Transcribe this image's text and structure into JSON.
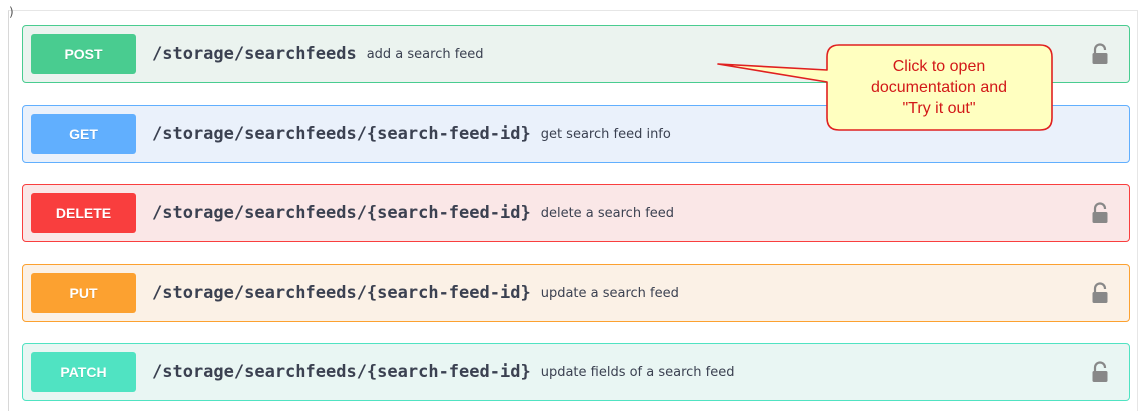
{
  "operations": [
    {
      "method": "POST",
      "path": "/storage/searchfeeds",
      "summary": "add a search feed",
      "locked": true
    },
    {
      "method": "GET",
      "path": "/storage/searchfeeds/{search-feed-id}",
      "summary": "get search feed info",
      "locked": false
    },
    {
      "method": "DELETE",
      "path": "/storage/searchfeeds/{search-feed-id}",
      "summary": "delete a search feed",
      "locked": true
    },
    {
      "method": "PUT",
      "path": "/storage/searchfeeds/{search-feed-id}",
      "summary": "update a search feed",
      "locked": true
    },
    {
      "method": "PATCH",
      "path": "/storage/searchfeeds/{search-feed-id}",
      "summary": "update fields of a search feed",
      "locked": true
    }
  ],
  "callout": {
    "lines": [
      "Click to open",
      "documentation and",
      "\"Try it out\""
    ]
  },
  "colors": {
    "post": "#49cc90",
    "get": "#61affe",
    "delete": "#f93e3e",
    "put": "#fca130",
    "patch": "#50e3c2",
    "callout_fill": "#ffffc0",
    "callout_border": "#e02020"
  },
  "icons": {
    "lock": "lock-icon",
    "corner": ")"
  }
}
